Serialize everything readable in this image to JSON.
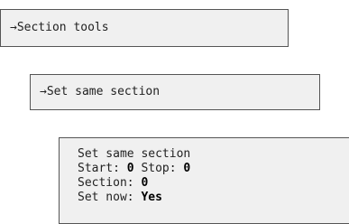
{
  "menu_level1": {
    "label": "→Section tools"
  },
  "menu_level2": {
    "label": "→Set same section"
  },
  "panel": {
    "title": "Set same section",
    "start_label": "Start: ",
    "start_value": "0",
    "stop_label": " Stop: ",
    "stop_value": "0",
    "section_label": "Section: ",
    "section_value": "0",
    "set_now_label": "Set now: ",
    "set_now_value": "Yes"
  }
}
